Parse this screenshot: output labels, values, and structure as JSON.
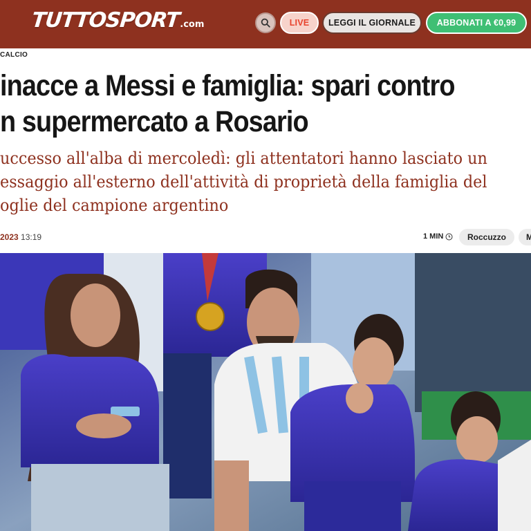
{
  "header": {
    "logo_main": "TUTTOSPORT",
    "logo_suffix": ".com",
    "live_label": "LIVE",
    "newspaper_label": "LEGGI IL GIORNALE",
    "subscribe_label": "ABBONATI A €0,99",
    "icons": {
      "search": "search-icon"
    },
    "colors": {
      "brand": "#8e311f",
      "live": "#e8432e",
      "subscribe": "#3fbf74"
    }
  },
  "article": {
    "category": "CALCIO",
    "title_lines": [
      "inacce a Messi e famiglia: spari contro",
      "n supermercato a Rosario"
    ],
    "subtitle_lines": [
      "uccesso all'alba di mercoledì: gli attentatori hanno lasciato un",
      "essaggio all'esterno dell'attività di proprietà della famiglia del",
      "oglie del campione argentino"
    ],
    "date": "2023",
    "time": "13:19",
    "read_time": "1 MIN",
    "tags": [
      "Roccuzzo",
      "M"
    ],
    "icons": {
      "clock": "clock-icon"
    }
  }
}
